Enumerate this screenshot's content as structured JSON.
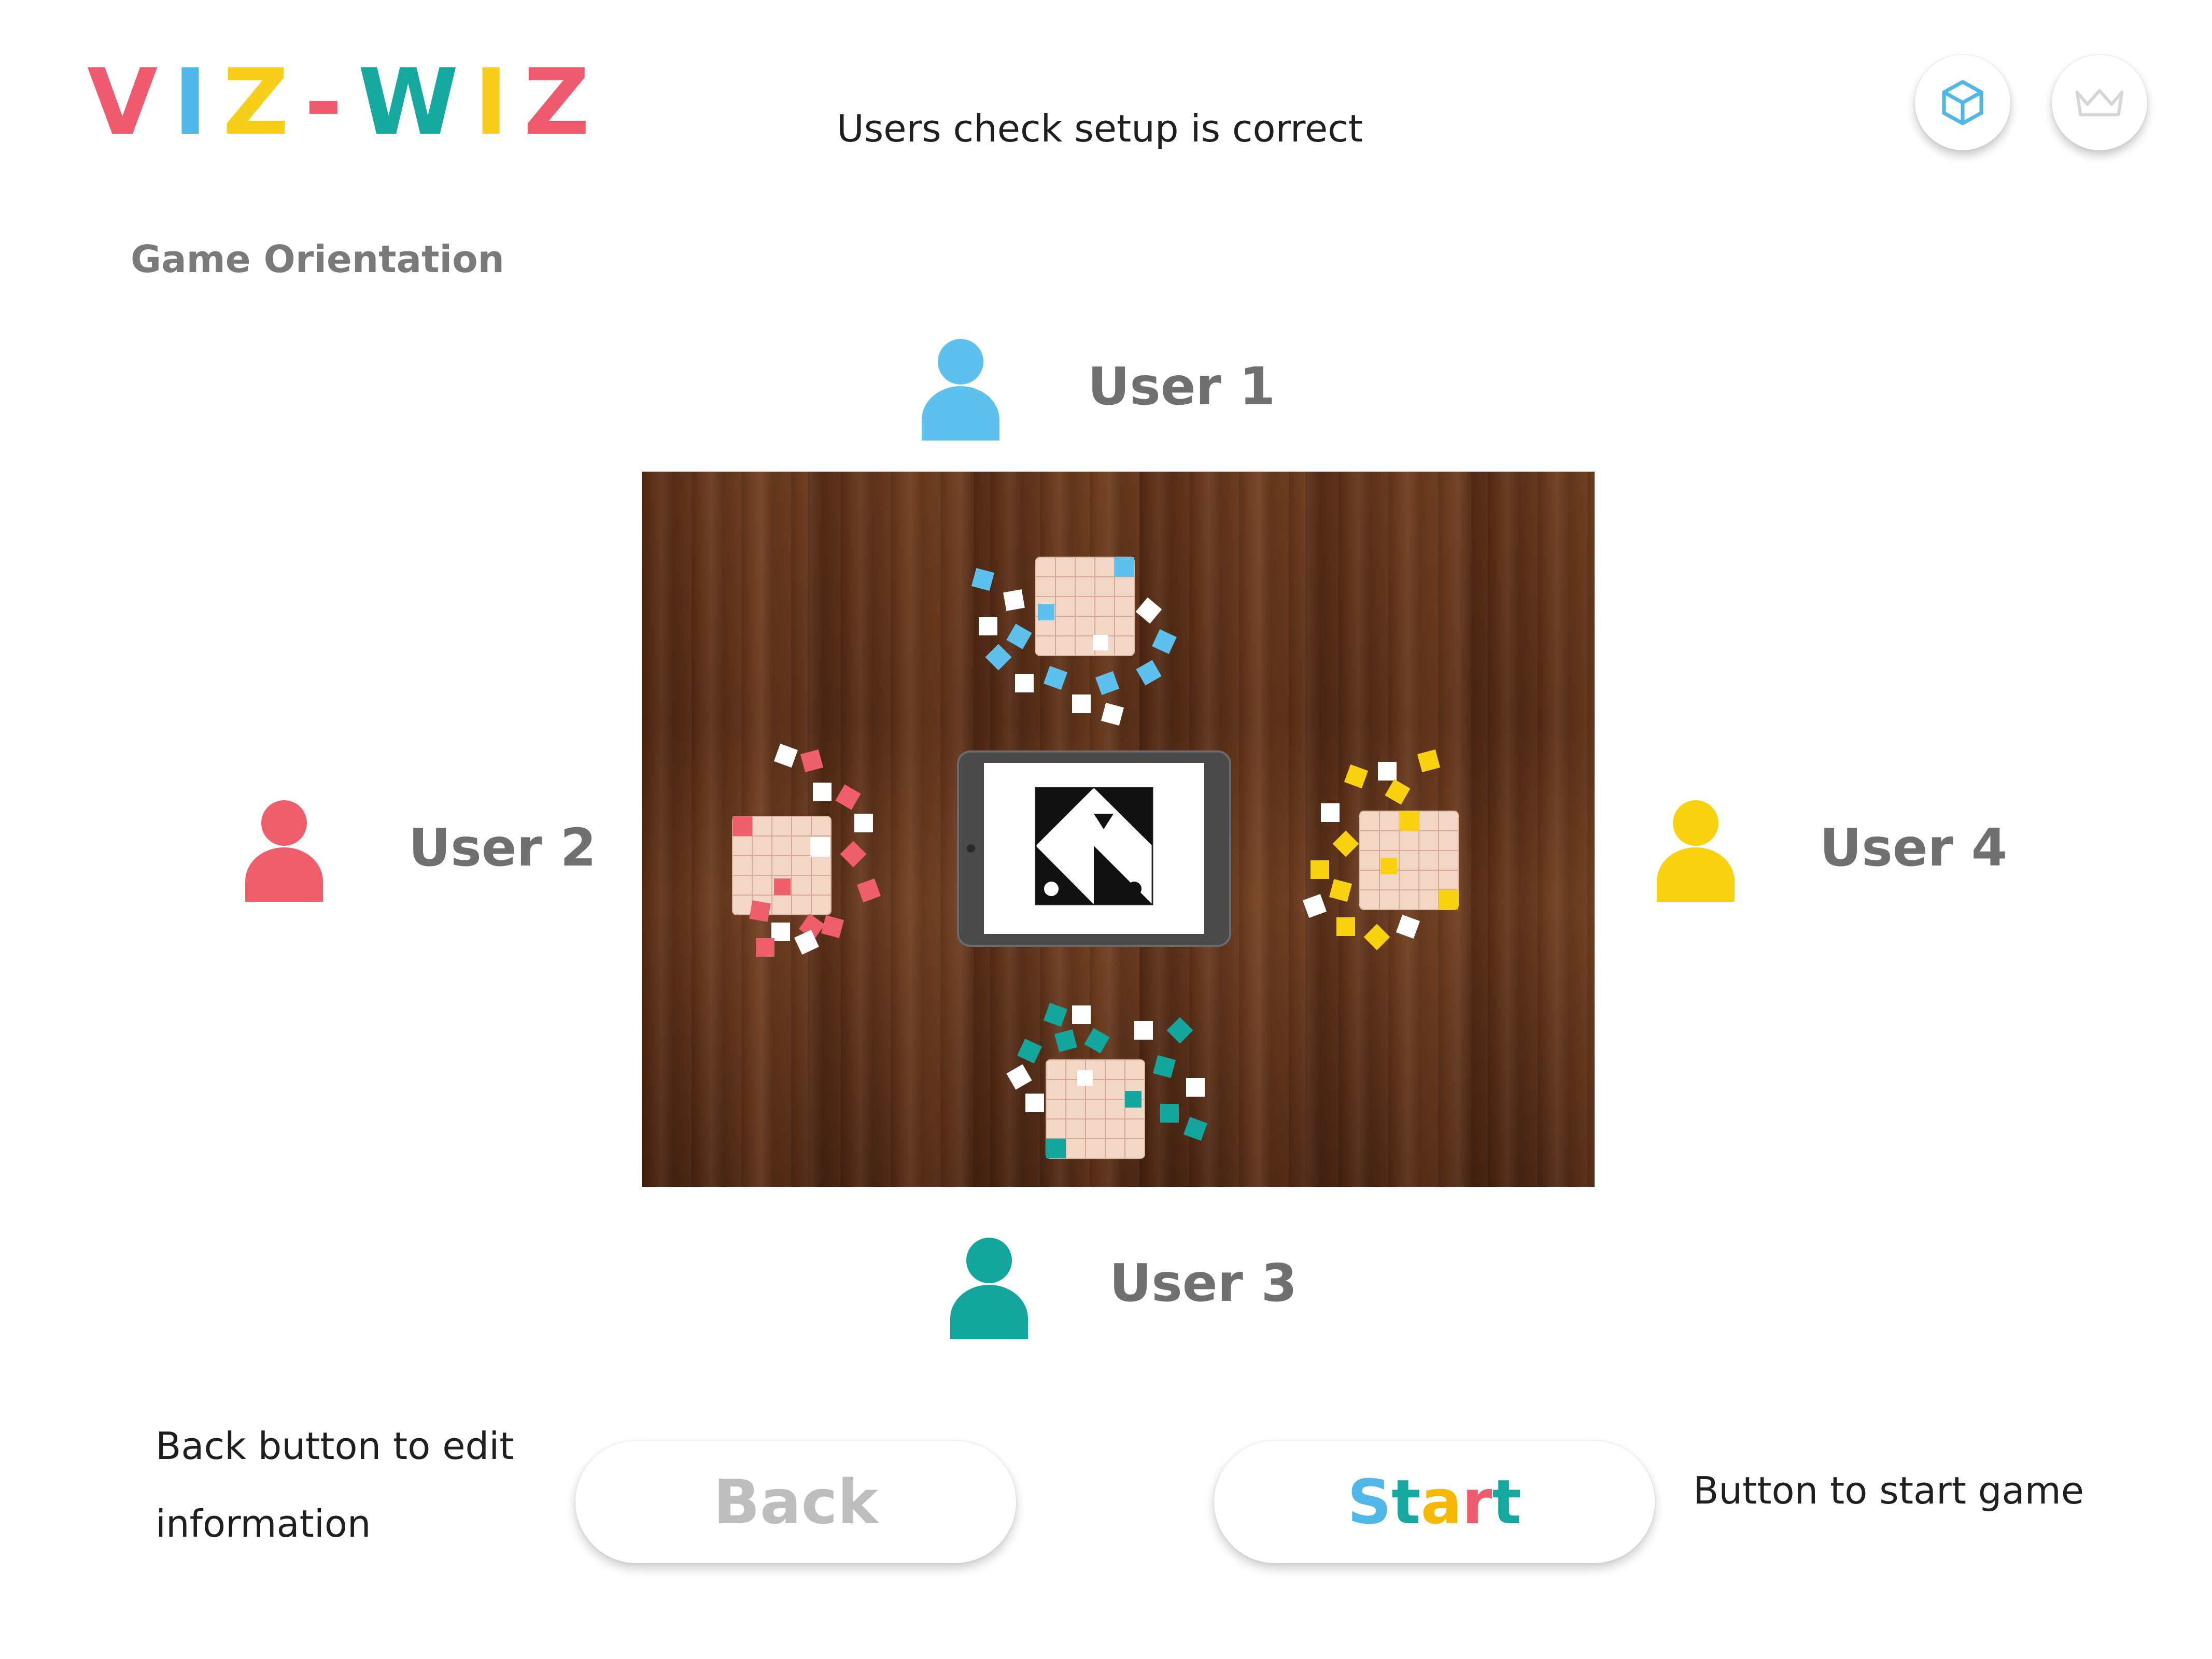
{
  "header": {
    "logo_letters": [
      "V",
      "I",
      "Z",
      "-",
      "W",
      "I",
      "Z"
    ],
    "logo_colors": [
      "#ef5a6f",
      "#4fb8e8",
      "#f7cf1a",
      "#ef5a6f",
      "#16a99f",
      "#f7cf1a",
      "#ef5a6f"
    ],
    "annotation": "Users check setup is correct",
    "icons": [
      "cube-icon",
      "crown-icon"
    ]
  },
  "section_title": "Game Orientation",
  "users": [
    {
      "label": "User 1",
      "color": "#5ec0ec"
    },
    {
      "label": "User 2",
      "color": "#ef5f6b"
    },
    {
      "label": "User 3",
      "color": "#13a69c"
    },
    {
      "label": "User 4",
      "color": "#f8d10f"
    }
  ],
  "buttons": {
    "back_label": "Back",
    "start_letters": [
      "S",
      "t",
      "a",
      "r",
      "t"
    ],
    "start_colors": [
      "#4fb8e8",
      "#16a99f",
      "#f7b900",
      "#ef5a6f",
      "#16a99f"
    ]
  },
  "annotations": {
    "back_line1": "Back button to edit",
    "back_line2": "information",
    "start": "Button to start game"
  }
}
